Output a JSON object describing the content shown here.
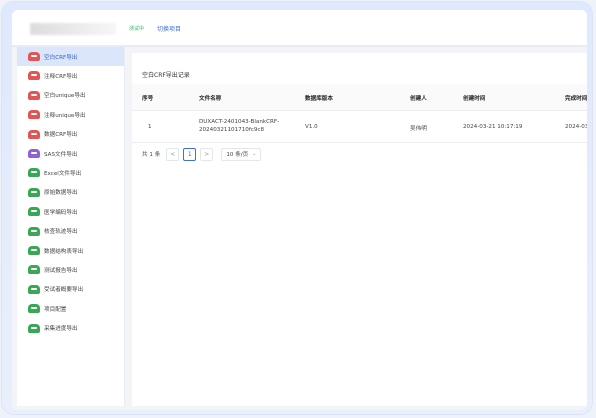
{
  "header": {
    "env_tag": "测试中",
    "switch_project": "切换项目"
  },
  "sidebar": {
    "items": [
      {
        "label": "空白CRF导出",
        "icon": "crf-file-icon",
        "color": "#e25555"
      },
      {
        "label": "注释CRF导出",
        "icon": "crf-file-icon",
        "color": "#e25555"
      },
      {
        "label": "空白unique导出",
        "icon": "crf-file-icon",
        "color": "#e25555"
      },
      {
        "label": "注释unique导出",
        "icon": "crf-file-icon",
        "color": "#e25555"
      },
      {
        "label": "数据CRF导出",
        "icon": "crf-file-icon",
        "color": "#e25555"
      },
      {
        "label": "SAS文件导出",
        "icon": "sas-file-icon",
        "color": "#8b63d6"
      },
      {
        "label": "Excel文件导出",
        "icon": "excel-file-icon",
        "color": "#3aa756"
      },
      {
        "label": "原始数据导出",
        "icon": "excel-file-icon",
        "color": "#3aa756"
      },
      {
        "label": "医学编码导出",
        "icon": "excel-file-icon",
        "color": "#3aa756"
      },
      {
        "label": "核查轨迹导出",
        "icon": "excel-file-icon",
        "color": "#3aa756"
      },
      {
        "label": "数据结构表导出",
        "icon": "excel-file-icon",
        "color": "#3aa756"
      },
      {
        "label": "测试报告导出",
        "icon": "excel-file-icon",
        "color": "#3aa756"
      },
      {
        "label": "受试者概要导出",
        "icon": "excel-file-icon",
        "color": "#3aa756"
      },
      {
        "label": "项目配置",
        "icon": "excel-file-icon",
        "color": "#3aa756"
      },
      {
        "label": "采集进度导出",
        "icon": "excel-file-icon",
        "color": "#3aa756"
      }
    ],
    "active_index": 0
  },
  "main": {
    "section_title": "空白CRF导出记录",
    "columns": [
      "序号",
      "文件名称",
      "数据库版本",
      "创建人",
      "创建时间",
      "完成时间"
    ],
    "rows": [
      {
        "index": "1",
        "file_line1": "DUXACT-2401043-BlankCRF-",
        "file_line2": "20240321101710fc9c8",
        "version": "V1.0",
        "creator": "吴伟明",
        "created": "2024-03-21 10:17:19",
        "completed": "2024-03-2"
      }
    ],
    "pagination": {
      "total": "共 1 条",
      "prev": "<",
      "current": "1",
      "next": ">",
      "page_size": "10 条/页"
    }
  }
}
